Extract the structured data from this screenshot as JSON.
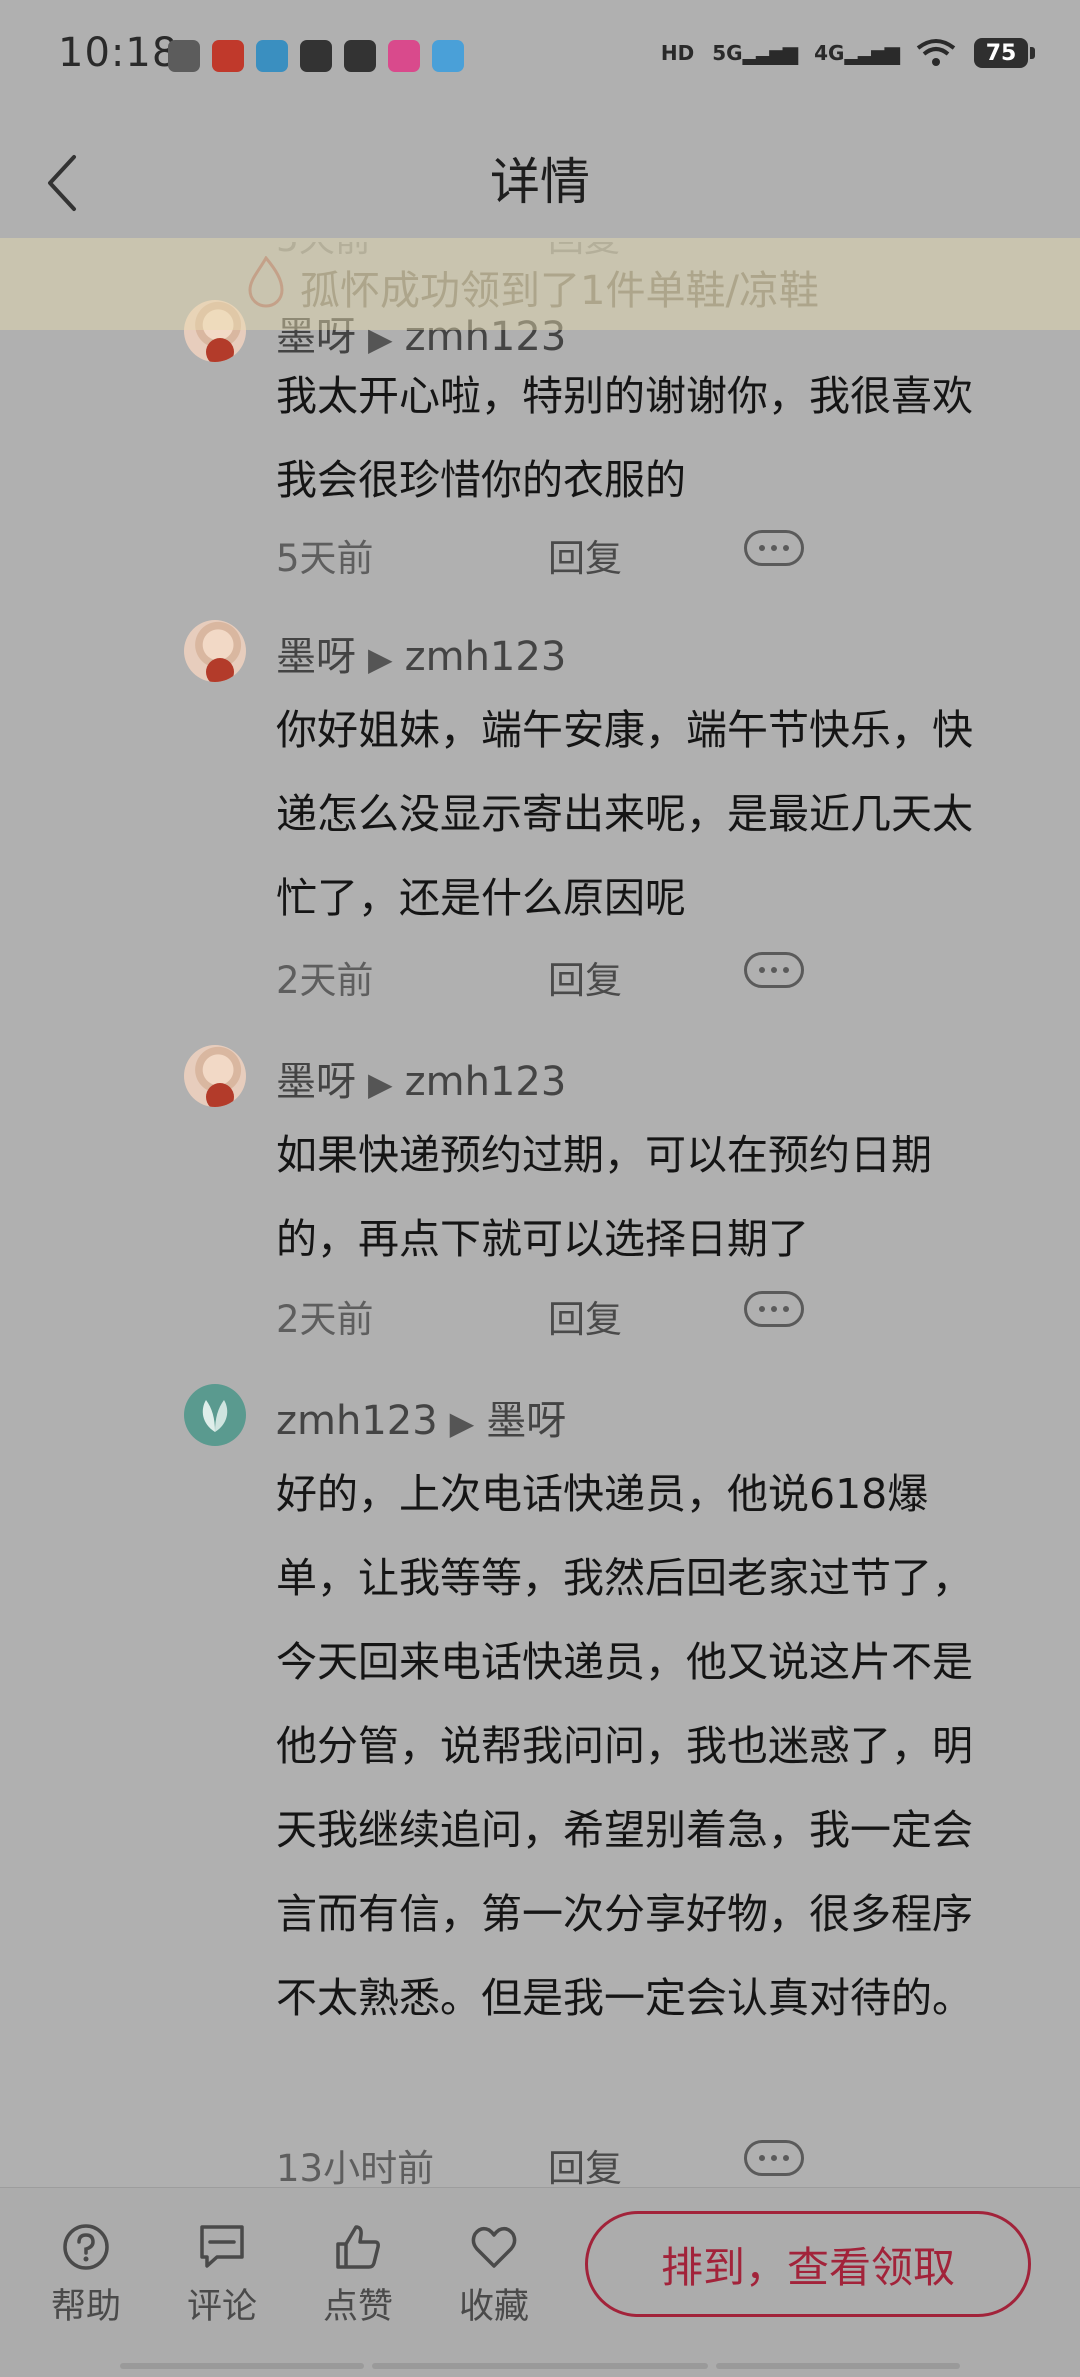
{
  "status_bar": {
    "time": "10:18",
    "hd_label": "HD",
    "signal_1": "5G",
    "signal_2": "4G",
    "battery": "75"
  },
  "header": {
    "title": "详情"
  },
  "toast": {
    "text": "孤怀成功领到了1件单鞋/凉鞋"
  },
  "comments": [
    {
      "author": "墨呀",
      "reply_to": "zmh123",
      "text": "我太开心啦，特别的谢谢你，我很喜欢我会很珍惜你的衣服的",
      "time": "5天前",
      "reply_label": "回复"
    },
    {
      "author": "墨呀",
      "reply_to": "zmh123",
      "text": "你好姐妹，端午安康，端午节快乐，快递怎么没显示寄出来呢，是最近几天太忙了，还是什么原因呢",
      "time": "2天前",
      "reply_label": "回复"
    },
    {
      "author": "墨呀",
      "reply_to": "zmh123",
      "text": "如果快递预约过期，可以在预约日期的，再点下就可以选择日期了",
      "time": "2天前",
      "reply_label": "回复"
    },
    {
      "author": "zmh123",
      "reply_to": "墨呀",
      "text": "好的，上次电话快递员，他说618爆单，让我等等，我然后回老家过节了，今天回来电话快递员，他又说这片不是他分管，说帮我问问，我也迷惑了，明天我继续追问，希望别着急，我一定会言而有信，第一次分享好物，很多程序不太熟悉。但是我一定会认真对待的。",
      "time": "13小时前",
      "reply_label": "回复"
    }
  ],
  "bottom_bar": {
    "help": "帮助",
    "comment": "评论",
    "like": "点赞",
    "favorite": "收藏",
    "cta": "排到，查看领取"
  },
  "colors": {
    "accent": "#a2233a",
    "overlay_bg": "#b0b0b0"
  }
}
